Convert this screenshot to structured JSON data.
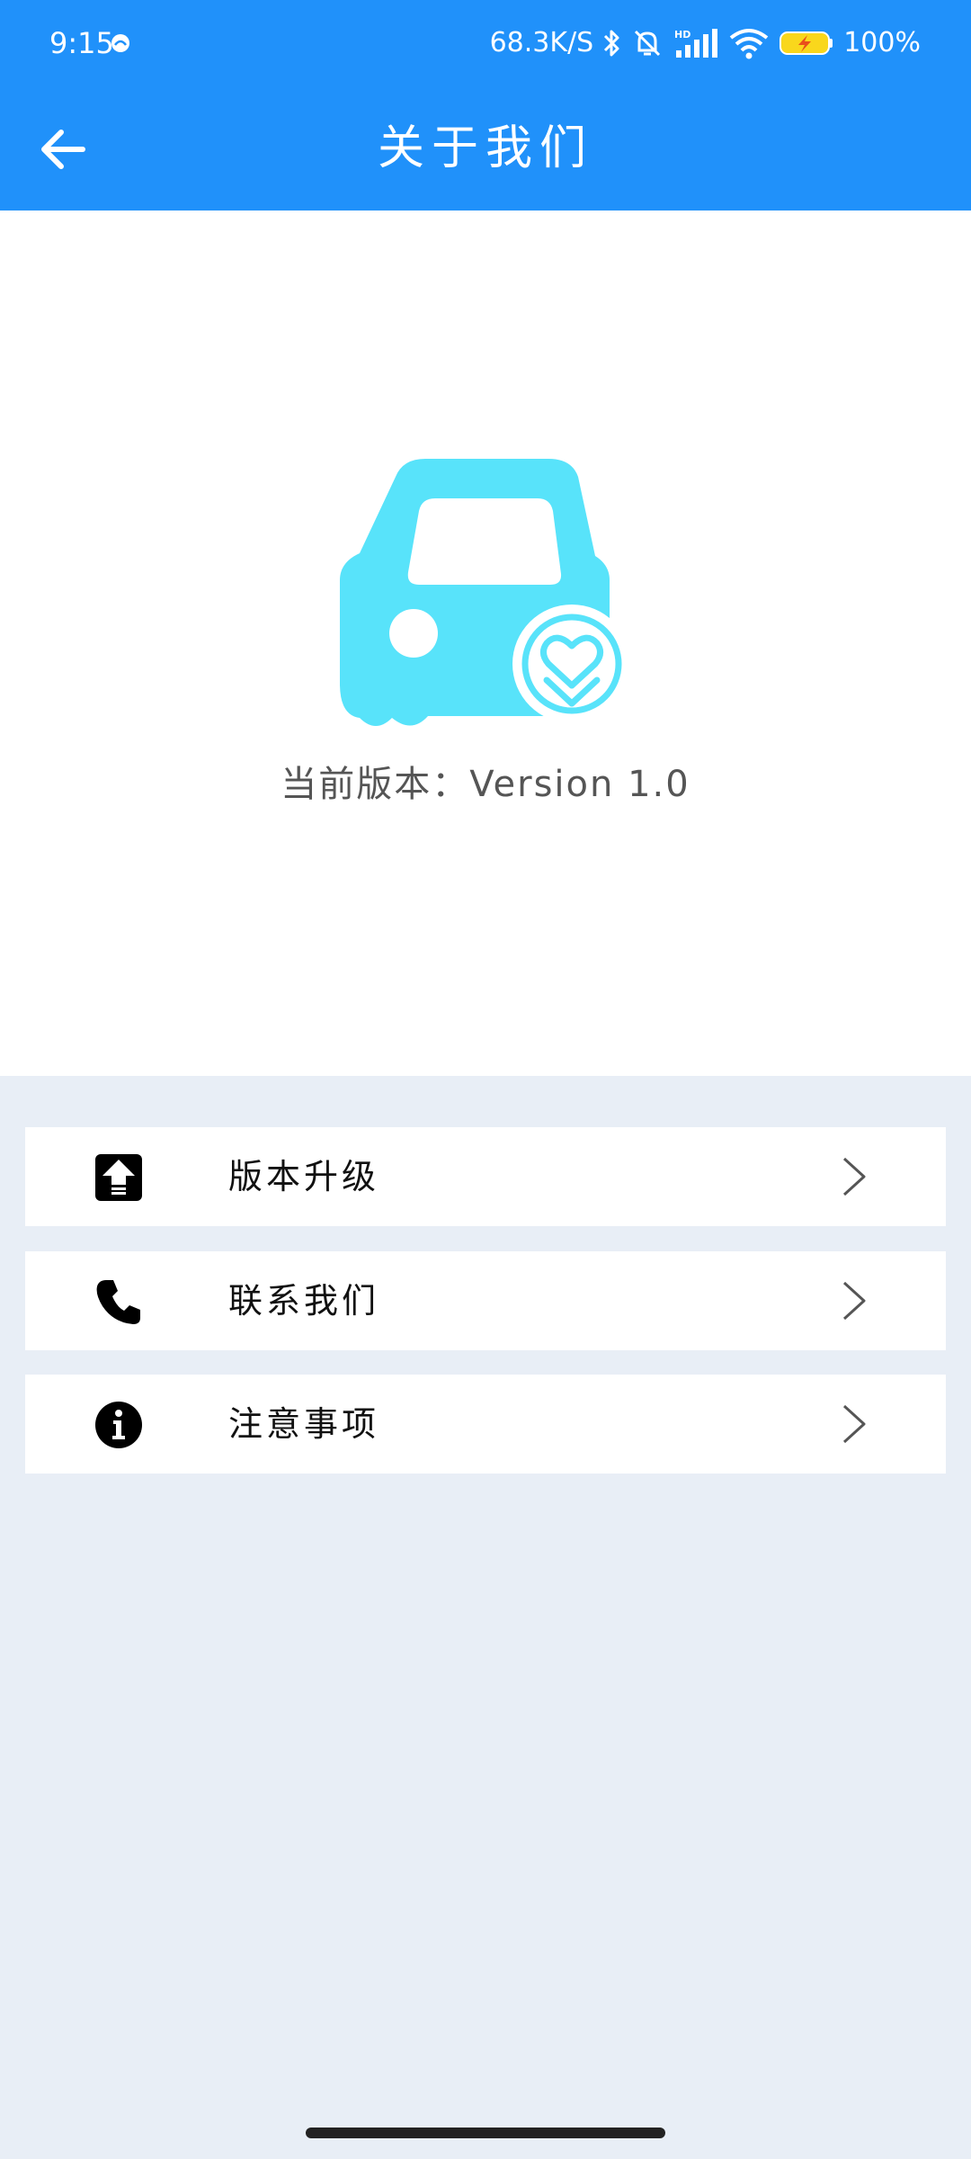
{
  "status_bar": {
    "time": "9:15",
    "network_speed": "68.3K/S",
    "battery": "100%"
  },
  "toolbar": {
    "title": "关于我们"
  },
  "about": {
    "version_label": "当前版本：",
    "version_value": "Version 1.0"
  },
  "menu": {
    "items": [
      {
        "label": "版本升级",
        "icon": "upload-arrow-icon"
      },
      {
        "label": "联系我们",
        "icon": "phone-icon"
      },
      {
        "label": "注意事项",
        "icon": "info-icon"
      }
    ]
  },
  "colors": {
    "primary": "#2091fa",
    "logo": "#58e3fa",
    "background": "#e8eef6"
  }
}
